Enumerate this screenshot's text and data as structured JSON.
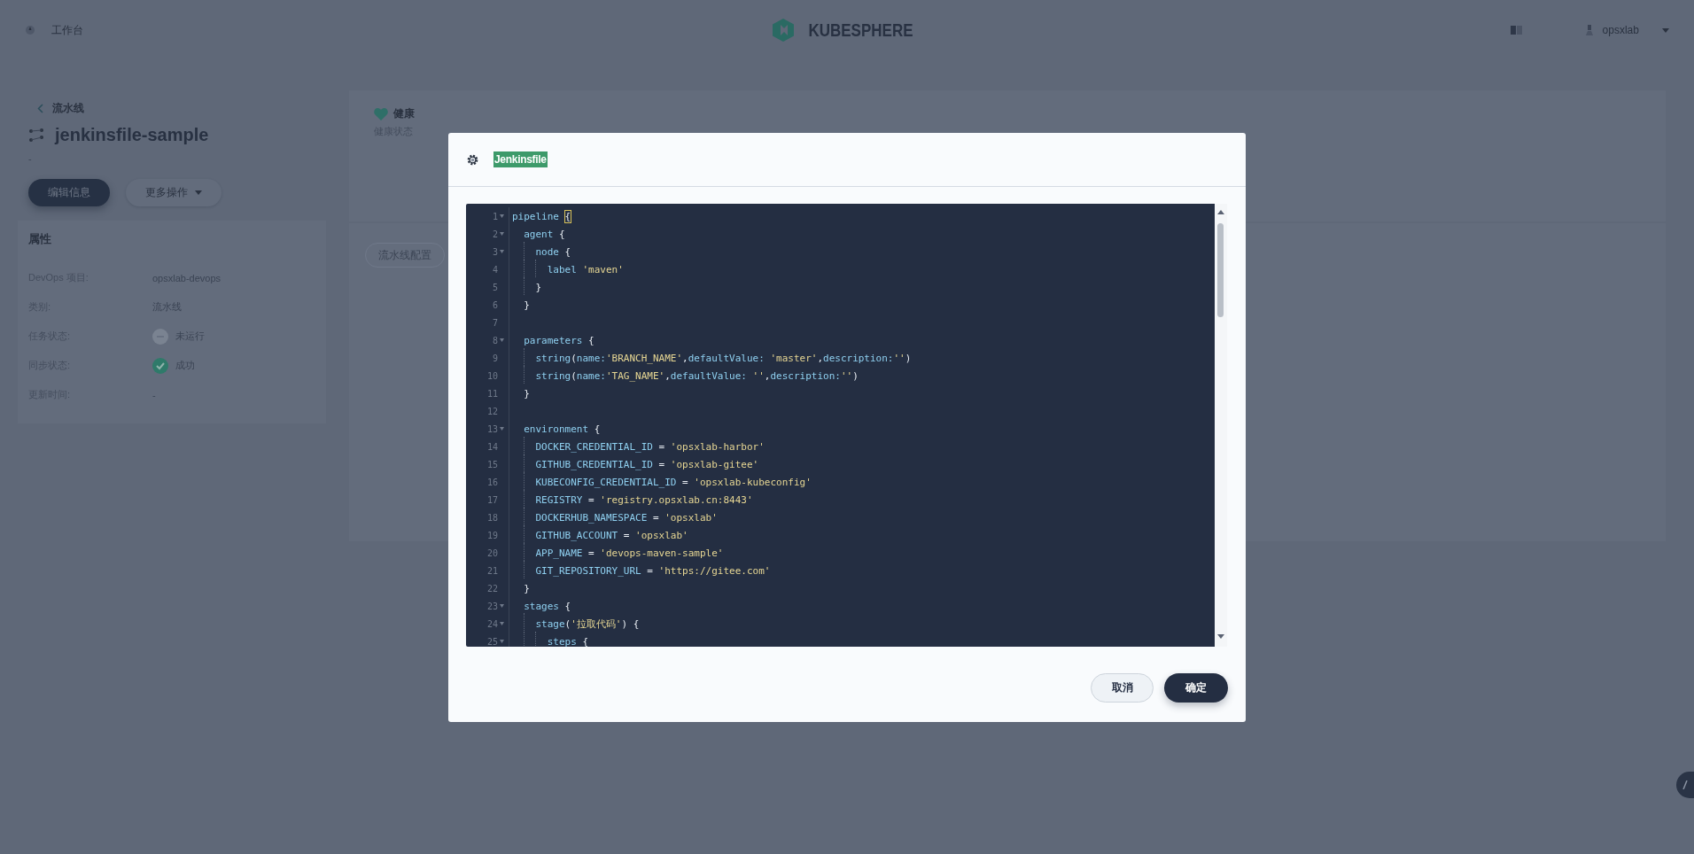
{
  "topbar": {
    "workbench": "工作台",
    "logo": "KUBESPHERE",
    "user": "opsxlab"
  },
  "sidebar": {
    "back": "流水线",
    "title": "jenkinsfile-sample",
    "description": "-",
    "section": "属性",
    "buttons": [
      {
        "label": "编辑信息",
        "kind": "primary"
      },
      {
        "label": "更多操作",
        "kind": "dropdown"
      }
    ],
    "properties": [
      {
        "label": "DevOps 项目:",
        "value": "opsxlab-devops",
        "kind": "text"
      },
      {
        "label": "类别:",
        "value": "流水线",
        "kind": "text"
      },
      {
        "label": "任务状态:",
        "value": "未运行",
        "kind": "idle"
      },
      {
        "label": "同步状态:",
        "value": "成功",
        "kind": "success"
      },
      {
        "label": "更新时间:",
        "value": "-",
        "kind": "text"
      }
    ]
  },
  "health": {
    "title": "健康",
    "subtitle": "健康状态"
  },
  "tabs": [
    {
      "label": "流水线配置",
      "selected": true
    }
  ],
  "dialog": {
    "title": "Jenkinsfile",
    "lines": [
      {
        "num": "1",
        "fold": true,
        "tokens": [
          {
            "kind": "kw",
            "text": "pipeline "
          },
          {
            "kind": "match",
            "text": "{"
          }
        ],
        "children": [
          {
            "num": "2",
            "fold": true,
            "tokens": [
              {
                "kind": "kw",
                "text": "agent"
              },
              {
                "kind": "p",
                "text": " {"
              }
            ],
            "children": [
              {
                "num": "3",
                "fold": true,
                "tokens": [
                  {
                    "kind": "kw",
                    "text": "node"
                  },
                  {
                    "kind": "p",
                    "text": " {"
                  }
                ],
                "children": [
                  {
                    "num": "4",
                    "fold": false,
                    "tokens": [
                      {
                        "kind": "kw",
                        "text": "label "
                      },
                      {
                        "kind": "str",
                        "text": "'maven'"
                      }
                    ]
                  }
                ]
              },
              {
                "num": "5",
                "fold": false,
                "tokens": [
                  {
                    "kind": "p",
                    "text": "}"
                  }
                ]
              }
            ]
          },
          {
            "num": "6",
            "fold": false,
            "tokens": [
              {
                "kind": "p",
                "text": "}"
              }
            ]
          },
          {
            "num": "7",
            "fold": false
          },
          {
            "num": "8",
            "fold": true,
            "tokens": [
              {
                "kind": "kw",
                "text": "parameters"
              },
              {
                "kind": "p",
                "text": " {"
              }
            ],
            "children": [
              {
                "num": "9",
                "fold": false,
                "tokens": [
                  {
                    "kind": "kw",
                    "text": "string"
                  },
                  {
                    "kind": "p",
                    "text": "("
                  },
                  {
                    "kind": "kw",
                    "text": "name:"
                  },
                  {
                    "kind": "str",
                    "text": "'BRANCH_NAME'"
                  },
                  {
                    "kind": "p",
                    "text": ","
                  },
                  {
                    "kind": "kw",
                    "text": "defaultValue: "
                  },
                  {
                    "kind": "str",
                    "text": "'master'"
                  },
                  {
                    "kind": "p",
                    "text": ","
                  },
                  {
                    "kind": "kw",
                    "text": "description:"
                  },
                  {
                    "kind": "str",
                    "text": "''"
                  },
                  {
                    "kind": "p",
                    "text": ")"
                  }
                ]
              },
              {
                "num": "10",
                "fold": false,
                "tokens": [
                  {
                    "kind": "kw",
                    "text": "string"
                  },
                  {
                    "kind": "p",
                    "text": "("
                  },
                  {
                    "kind": "kw",
                    "text": "name:"
                  },
                  {
                    "kind": "str",
                    "text": "'TAG_NAME'"
                  },
                  {
                    "kind": "p",
                    "text": ","
                  },
                  {
                    "kind": "kw",
                    "text": "defaultValue: "
                  },
                  {
                    "kind": "str",
                    "text": "''"
                  },
                  {
                    "kind": "p",
                    "text": ","
                  },
                  {
                    "kind": "kw",
                    "text": "description:"
                  },
                  {
                    "kind": "str",
                    "text": "''"
                  },
                  {
                    "kind": "p",
                    "text": ")"
                  }
                ]
              }
            ]
          },
          {
            "num": "11",
            "fold": false,
            "tokens": [
              {
                "kind": "p",
                "text": "}"
              }
            ]
          },
          {
            "num": "12",
            "fold": false
          },
          {
            "num": "13",
            "fold": true,
            "tokens": [
              {
                "kind": "kw",
                "text": "environment"
              },
              {
                "kind": "p",
                "text": " {"
              }
            ],
            "children": [
              {
                "num": "14",
                "fold": false,
                "tokens": [
                  {
                    "kind": "kw",
                    "text": "DOCKER_CREDENTIAL_ID"
                  },
                  {
                    "kind": "p",
                    "text": " = "
                  },
                  {
                    "kind": "str",
                    "text": "'opsxlab-harbor'"
                  }
                ]
              },
              {
                "num": "15",
                "fold": false,
                "tokens": [
                  {
                    "kind": "kw",
                    "text": "GITHUB_CREDENTIAL_ID"
                  },
                  {
                    "kind": "p",
                    "text": " = "
                  },
                  {
                    "kind": "str",
                    "text": "'opsxlab-gitee'"
                  }
                ]
              },
              {
                "num": "16",
                "fold": false,
                "tokens": [
                  {
                    "kind": "kw",
                    "text": "KUBECONFIG_CREDENTIAL_ID"
                  },
                  {
                    "kind": "p",
                    "text": " = "
                  },
                  {
                    "kind": "str",
                    "text": "'opsxlab-kubeconfig'"
                  }
                ]
              },
              {
                "num": "17",
                "fold": false,
                "tokens": [
                  {
                    "kind": "kw",
                    "text": "REGISTRY"
                  },
                  {
                    "kind": "p",
                    "text": " = "
                  },
                  {
                    "kind": "str",
                    "text": "'registry.opsxlab.cn:8443'"
                  }
                ]
              },
              {
                "num": "18",
                "fold": false,
                "tokens": [
                  {
                    "kind": "kw",
                    "text": "DOCKERHUB_NAMESPACE"
                  },
                  {
                    "kind": "p",
                    "text": " = "
                  },
                  {
                    "kind": "str",
                    "text": "'opsxlab'"
                  }
                ]
              },
              {
                "num": "19",
                "fold": false,
                "tokens": [
                  {
                    "kind": "kw",
                    "text": "GITHUB_ACCOUNT"
                  },
                  {
                    "kind": "p",
                    "text": " = "
                  },
                  {
                    "kind": "str",
                    "text": "'opsxlab'"
                  }
                ]
              },
              {
                "num": "20",
                "fold": false,
                "tokens": [
                  {
                    "kind": "kw",
                    "text": "APP_NAME"
                  },
                  {
                    "kind": "p",
                    "text": " = "
                  },
                  {
                    "kind": "str",
                    "text": "'devops-maven-sample'"
                  }
                ]
              },
              {
                "num": "21",
                "fold": false,
                "tokens": [
                  {
                    "kind": "kw",
                    "text": "GIT_REPOSITORY_URL"
                  },
                  {
                    "kind": "p",
                    "text": " = "
                  },
                  {
                    "kind": "str",
                    "text": "'https://gitee.com'"
                  }
                ]
              }
            ]
          },
          {
            "num": "22",
            "fold": false,
            "tokens": [
              {
                "kind": "p",
                "text": "}"
              }
            ]
          },
          {
            "num": "23",
            "fold": true,
            "tokens": [
              {
                "kind": "kw",
                "text": "stages"
              },
              {
                "kind": "p",
                "text": " {"
              }
            ],
            "children": [
              {
                "num": "24",
                "fold": true,
                "tokens": [
                  {
                    "kind": "kw",
                    "text": "stage"
                  },
                  {
                    "kind": "p",
                    "text": "("
                  },
                  {
                    "kind": "str",
                    "text": "'拉取代码'"
                  },
                  {
                    "kind": "p",
                    "text": ") {"
                  }
                ],
                "children": [
                  {
                    "num": "25",
                    "fold": true,
                    "tokens": [
                      {
                        "kind": "kw",
                        "text": "steps"
                      },
                      {
                        "kind": "p",
                        "text": " {"
                      }
                    ]
                  }
                ]
              }
            ]
          }
        ]
      }
    ],
    "buttons": [
      {
        "label": "取消",
        "kind": "secondary"
      },
      {
        "label": "确定",
        "kind": "primary"
      }
    ]
  }
}
